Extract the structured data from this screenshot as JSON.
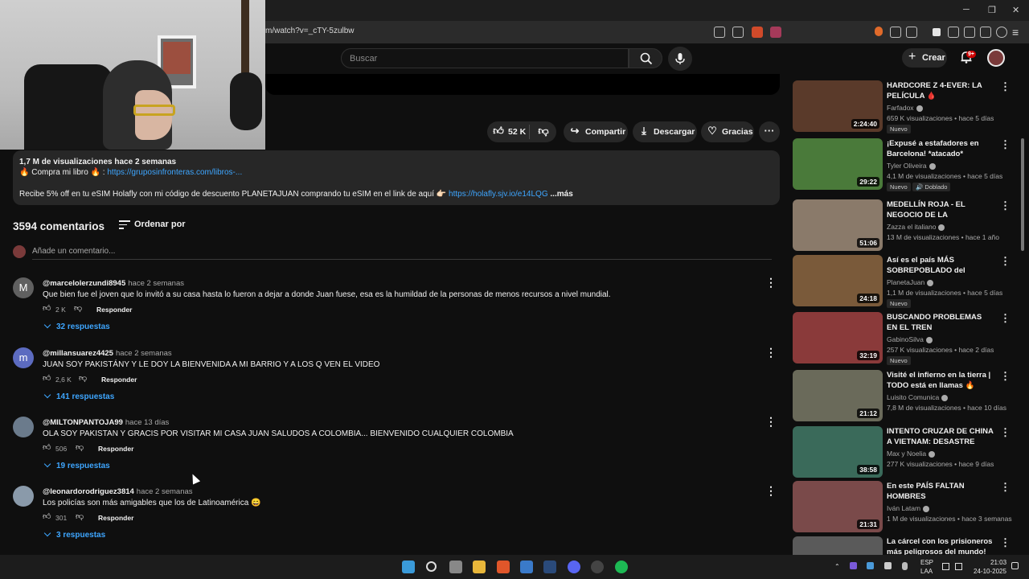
{
  "browser": {
    "url": "m/watch?v=_cTY-5zulbw",
    "window_controls": [
      "─",
      "❐",
      "✕"
    ]
  },
  "header": {
    "search_placeholder": "Buscar",
    "create_label": "Crear",
    "notifications_badge": "9+"
  },
  "video": {
    "actions": {
      "likes": "52 K",
      "share": "Compartir",
      "download": "Descargar",
      "thanks": "Gracias"
    },
    "description": {
      "meta": "1,7 M de visualizaciones  hace 2 semanas",
      "line2_prefix": "🔥 Compra mi libro 🔥 : ",
      "line2_link": "https://gruposinfronteras.com/libros-...",
      "line3_text": "Recibe 5% off en tu eSIM Holafly con mi código de descuento PLANETAJUAN comprando tu eSIM en el link de aquí 👉🏻 ",
      "line3_link": "https://holafly.sjv.io/e14LQG",
      "more": "...más"
    }
  },
  "comments": {
    "count": "3594 comentarios",
    "sort_label": "Ordenar por",
    "add_placeholder": "Añade un comentario...",
    "reply_label": "Responder",
    "items": [
      {
        "author": "@marcelolerzundi8945",
        "time": "hace 2 semanas",
        "text": "Que bien fue el joven que lo invitó a su casa hasta lo fueron a dejar a donde Juan fuese, esa es la humildad de la personas de menos recursos a nivel mundial.",
        "likes": "2 K",
        "replies": "32 respuestas",
        "avatar_letter": "M",
        "avatar_color": "#606060"
      },
      {
        "author": "@millansuarez4425",
        "time": "hace 2 semanas",
        "text": "JUAN SOY PAKISTÁNY Y LE DOY LA BIENVENIDA A MI BARRIO Y A LOS Q VEN EL VIDEO",
        "likes": "2,6 K",
        "replies": "141 respuestas",
        "avatar_letter": "m",
        "avatar_color": "#5c6bc0"
      },
      {
        "author": "@MILTONPANTOJA99",
        "time": "hace 13 días",
        "text": "OLA SOY PAKISTAN Y GRACIS POR VISITAR MI CASA JUAN SALUDOS A COLOMBIA... BIENVENIDO CUALQUIER COLOMBIA",
        "likes": "506",
        "replies": "19 respuestas",
        "avatar_letter": "",
        "avatar_color": "#6b7b8c"
      },
      {
        "author": "@leonardorodriguez3814",
        "time": "hace 2 semanas",
        "text": "Los policías son más amigables que los de Latinoamérica 😄",
        "likes": "301",
        "replies": "3 respuestas",
        "avatar_letter": "",
        "avatar_color": "#8a9aaa"
      }
    ]
  },
  "sidebar": {
    "items": [
      {
        "title": "HARDCORE Z 4-EVER: LA PELÍCULA 🩸",
        "channel": "Farfadox",
        "stats": "659 K visualizaciones • hace 5 días",
        "duration": "2:24:40",
        "badge": "Nuevo",
        "badge2": "",
        "thumb_color": "#5a3a2a"
      },
      {
        "title": "¡Expusé a estafadores en Barcelona! *atacado*",
        "channel": "Tyler Oliveira",
        "stats": "4,1 M de visualizaciones • hace 5 días",
        "duration": "29:22",
        "badge": "Nuevo",
        "badge2": "🔊 Doblado",
        "thumb_color": "#4a7a3a"
      },
      {
        "title": "MEDELLÍN ROJA - EL NEGOCIO DE LA PROSTITUCIÓN co",
        "channel": "Zazza el italiano",
        "stats": "13 M de visualizaciones • hace 1 año",
        "duration": "51:06",
        "badge": "",
        "badge2": "",
        "thumb_color": "#8a7a6a"
      },
      {
        "title": "Así es el país MÁS SOBREPOBLADO del Planeta ...",
        "channel": "PlanetaJuan",
        "stats": "1,1 M de visualizaciones • hace 5 días",
        "duration": "24:18",
        "badge": "Nuevo",
        "badge2": "",
        "thumb_color": "#7a5a3a"
      },
      {
        "title": "BUSCANDO PROBLEMAS EN EL TREN",
        "channel": "GabinoSilva",
        "stats": "257 K visualizaciones • hace 2 días",
        "duration": "32:19",
        "badge": "Nuevo",
        "badge2": "",
        "thumb_color": "#8a3a3a"
      },
      {
        "title": "Visité el infierno en la tierra | TODO está en llamas 🔥",
        "channel": "Luisito Comunica",
        "stats": "7,8 M de visualizaciones • hace 10 días",
        "duration": "21:12",
        "badge": "",
        "badge2": "",
        "thumb_color": "#6a6a5a"
      },
      {
        "title": "INTENTO CRUZAR DE CHINA A VIETNAM: DESASTRE TOTAL",
        "channel": "Max y Noelia",
        "stats": "277 K visualizaciones • hace 9 días",
        "duration": "38:58",
        "badge": "",
        "badge2": "",
        "thumb_color": "#3a6a5a"
      },
      {
        "title": "En este PAÍS FALTAN HOMBRES",
        "channel": "Iván Latam",
        "stats": "1 M de visualizaciones • hace 3 semanas",
        "duration": "21:31",
        "badge": "",
        "badge2": "",
        "thumb_color": "#7a4a4a"
      },
      {
        "title": "La cárcel con los prisioneros más peligrosos del mundo!",
        "channel": "",
        "stats": "",
        "duration": "",
        "badge": "",
        "badge2": "",
        "thumb_color": "#5a5a5a"
      }
    ]
  },
  "taskbar": {
    "lang": "ESP",
    "layout": "LAA",
    "time": "21:03",
    "date": "24-10-2025"
  }
}
